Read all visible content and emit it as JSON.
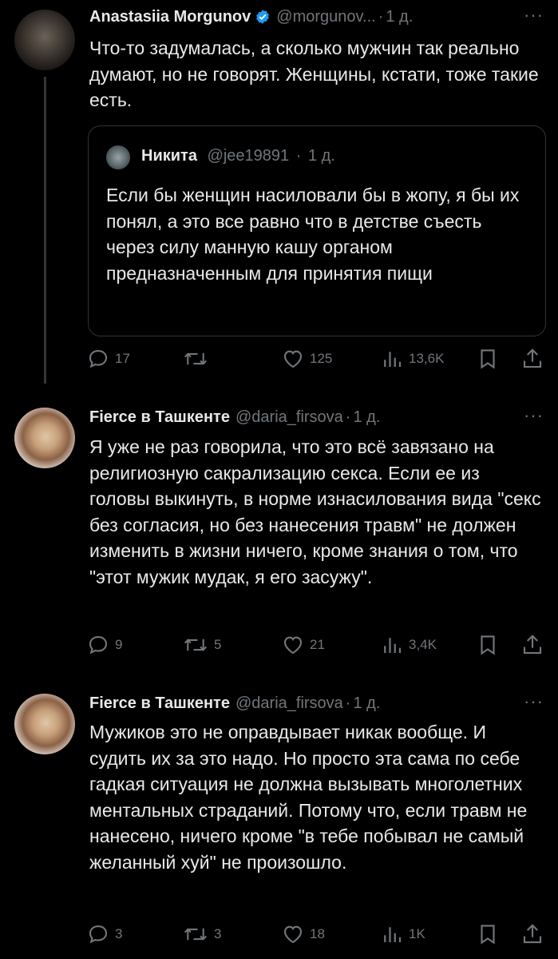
{
  "tweets": [
    {
      "author": "Anastasiia Morgunov",
      "handle": "@morgunov...",
      "time": "1 д.",
      "verified": true,
      "text": "Что-то задумалась, а сколько мужчин так реально думают, но не говорят. Женщины, кстати, тоже такие есть.",
      "quote": {
        "author": "Никита",
        "handle": "@jee19891",
        "time": "1 д.",
        "text": "Если бы женщин насиловали бы в жопу, я бы их понял, а это все равно что в детстве съесть через силу манную кашу органом предназначенным для принятия пищи"
      },
      "stats": {
        "replies": "17",
        "retweets": "",
        "likes": "125",
        "views": "13,6K"
      }
    },
    {
      "author": "Fierce в Ташкенте",
      "handle": "@daria_firsova",
      "time": "1 д.",
      "text": "Я уже не раз говорила, что это всё завязано на религиозную сакрализацию секса. Если ее из головы выкинуть, в норме изнасилования вида \"секс без согласия, но без нанесения травм\" не должен изменить в жизни ничего, кроме знания о том, что \"этот мужик мудак, я его засужу\".",
      "stats": {
        "replies": "9",
        "retweets": "5",
        "likes": "21",
        "views": "3,4K"
      }
    },
    {
      "author": "Fierce в Ташкенте",
      "handle": "@daria_firsova",
      "time": "1 д.",
      "text": "Мужиков это не оправдывает никак вообще. И судить их за это надо. Но просто эта сама по себе гадкая ситуация не должна вызывать многолетних ментальных страданий. Потому что, если травм не нанесено, ничего кроме \"в тебе побывал не самый желанный хуй\" не произошло.",
      "stats": {
        "replies": "3",
        "retweets": "3",
        "likes": "18",
        "views": "1K"
      }
    }
  ],
  "colors": {
    "background": "#000000",
    "text": "#e7e9ea",
    "muted": "#71767b",
    "verified": "#1d9bf0",
    "border": "#2f3336"
  },
  "icons": [
    "verified-badge-icon",
    "reply-icon",
    "retweet-icon",
    "like-icon",
    "views-icon",
    "bookmark-icon",
    "share-icon",
    "more-icon"
  ]
}
